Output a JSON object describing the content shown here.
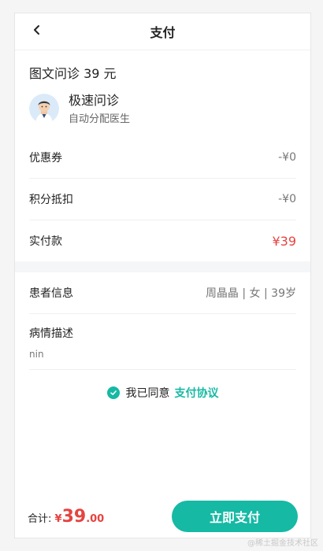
{
  "nav": {
    "title": "支付"
  },
  "order": {
    "title": "图文问诊 39 元"
  },
  "doctor": {
    "name": "极速问诊",
    "subtitle": "自动分配医生"
  },
  "fees": [
    {
      "label": "优惠券",
      "value": "-¥0"
    },
    {
      "label": "积分抵扣",
      "value": "-¥0"
    },
    {
      "label": "实付款",
      "value": "¥39"
    }
  ],
  "patient": {
    "label": "患者信息",
    "value": "周晶晶 | 女 | 39岁"
  },
  "illness": {
    "label": "病情描述",
    "text": "nin"
  },
  "agreement": {
    "text": "我已同意",
    "link": "支付协议"
  },
  "footer": {
    "total_label": "合计:",
    "currency": "¥",
    "amount_int": "39",
    "amount_dec": ".00",
    "pay_button": "立即支付"
  },
  "watermark": "@稀土掘金技术社区",
  "colors": {
    "accent": "#16b9a4",
    "price": "#e64340"
  },
  "icons": {
    "back": "chevron-left-icon",
    "check": "check-circle-icon",
    "avatar": "doctor-avatar"
  }
}
